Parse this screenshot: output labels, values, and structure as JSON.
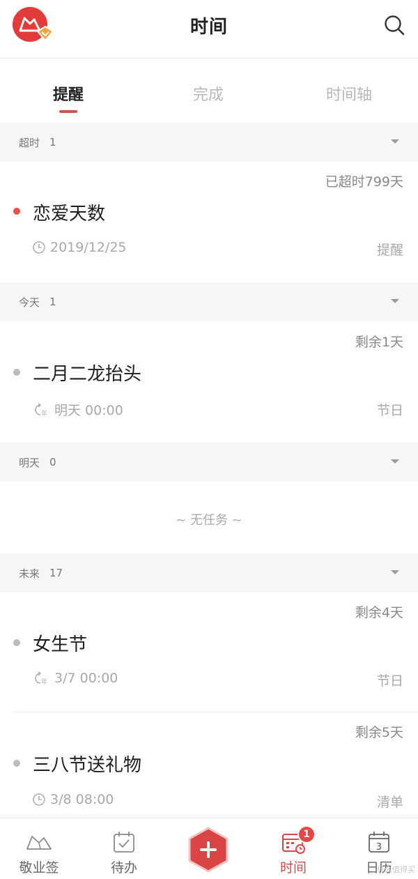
{
  "header": {
    "title": "时间"
  },
  "tabs": [
    {
      "label": "提醒",
      "active": true
    },
    {
      "label": "完成",
      "active": false
    },
    {
      "label": "时间轴",
      "active": false
    }
  ],
  "sections": {
    "overdue": {
      "label": "超时",
      "count": "1"
    },
    "today": {
      "label": "今天",
      "count": "1"
    },
    "tomorrow": {
      "label": "明天",
      "count": "0",
      "empty_text": "~ 无任务 ~"
    },
    "future": {
      "label": "未来",
      "count": "17"
    }
  },
  "items": [
    {
      "remain": "已超时799天",
      "title": "恋爱天数",
      "meta": "2019/12/25",
      "kind": "提醒",
      "icon": "clock-icon"
    },
    {
      "remain": "剩余1天",
      "title": "二月二龙抬头",
      "meta": "明天 00:00",
      "kind": "节日",
      "icon": "repeat-yearly-icon"
    },
    {
      "remain": "剩余4天",
      "title": "女生节",
      "meta": "3/7 00:00",
      "kind": "节日",
      "icon": "repeat-yearly-icon"
    },
    {
      "remain": "剩余5天",
      "title": "三八节送礼物",
      "meta": "3/8 08:00",
      "kind": "清单",
      "icon": "clock-icon"
    }
  ],
  "bottom_nav": [
    {
      "label": "敬业签",
      "icon": "note-icon",
      "active": false
    },
    {
      "label": "待办",
      "icon": "todo-calendar-icon",
      "active": false
    },
    {
      "label": "",
      "icon": "add-icon",
      "active": false
    },
    {
      "label": "时间",
      "icon": "time-calendar-icon",
      "active": true,
      "badge": "1"
    },
    {
      "label": "日历",
      "icon": "calendar-icon",
      "active": false,
      "day": "3"
    }
  ],
  "watermark": "什么值得买",
  "colors": {
    "accent": "#e04a4a",
    "dot_red": "#e84f4f",
    "dot_grey": "#bdbdbd",
    "section_bg": "#f6f6f6"
  }
}
